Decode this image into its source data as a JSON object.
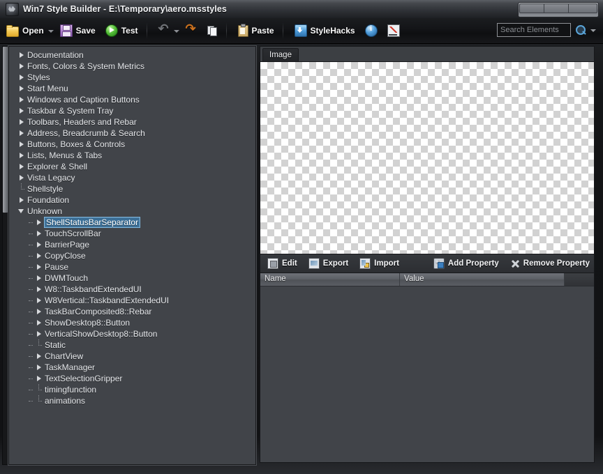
{
  "window": {
    "title": "Win7 Style Builder - E:\\Temporary\\aero.msstyles",
    "icon": "app-icon",
    "controls": [
      "minimize-button",
      "maximize-button",
      "close-button"
    ]
  },
  "toolbar": {
    "open_label": "Open",
    "save_label": "Save",
    "test_label": "Test",
    "paste_label": "Paste",
    "stylehacks_label": "StyleHacks",
    "undo_icon": "undo-icon",
    "undo_dropdown_icon": "chevron-down-icon",
    "redo_icon": "redo-icon",
    "copy_icon": "copy-icon",
    "info_icon": "info-icon",
    "chart_icon": "chart-icon"
  },
  "search": {
    "value": "",
    "placeholder": "Search Elements",
    "search_icon": "search-icon",
    "dropdown_icon": "chevron-down-icon"
  },
  "tree": {
    "items": [
      {
        "label": "Documentation",
        "indent": 0,
        "state": "collapsed"
      },
      {
        "label": "Fonts, Colors & System Metrics",
        "indent": 0,
        "state": "collapsed"
      },
      {
        "label": "Styles",
        "indent": 0,
        "state": "collapsed"
      },
      {
        "label": "Start Menu",
        "indent": 0,
        "state": "collapsed"
      },
      {
        "label": "Windows and Caption Buttons",
        "indent": 0,
        "state": "collapsed"
      },
      {
        "label": "Taskbar & System Tray",
        "indent": 0,
        "state": "collapsed"
      },
      {
        "label": "Toolbars, Headers and Rebar",
        "indent": 0,
        "state": "collapsed"
      },
      {
        "label": "Address, Breadcrumb & Search",
        "indent": 0,
        "state": "collapsed"
      },
      {
        "label": "Buttons, Boxes & Controls",
        "indent": 0,
        "state": "collapsed"
      },
      {
        "label": "Lists, Menus & Tabs",
        "indent": 0,
        "state": "collapsed"
      },
      {
        "label": "Explorer & Shell",
        "indent": 0,
        "state": "collapsed"
      },
      {
        "label": "Vista Legacy",
        "indent": 0,
        "state": "collapsed"
      },
      {
        "label": "Shellstyle",
        "indent": 0,
        "state": "leaf"
      },
      {
        "label": "Foundation",
        "indent": 0,
        "state": "collapsed"
      },
      {
        "label": "Unknown",
        "indent": 0,
        "state": "expanded"
      },
      {
        "label": "ShellStatusBarSeparator",
        "indent": 1,
        "state": "collapsed",
        "selected": true
      },
      {
        "label": "TouchScrollBar",
        "indent": 1,
        "state": "collapsed"
      },
      {
        "label": "BarrierPage",
        "indent": 1,
        "state": "collapsed"
      },
      {
        "label": "CopyClose",
        "indent": 1,
        "state": "collapsed"
      },
      {
        "label": "Pause",
        "indent": 1,
        "state": "collapsed"
      },
      {
        "label": "DWMTouch",
        "indent": 1,
        "state": "collapsed"
      },
      {
        "label": "W8::TaskbandExtendedUI",
        "indent": 1,
        "state": "collapsed"
      },
      {
        "label": "W8Vertical::TaskbandExtendedUI",
        "indent": 1,
        "state": "collapsed"
      },
      {
        "label": "TaskBarComposited8::Rebar",
        "indent": 1,
        "state": "collapsed"
      },
      {
        "label": "ShowDesktop8::Button",
        "indent": 1,
        "state": "collapsed"
      },
      {
        "label": "VerticalShowDesktop8::Button",
        "indent": 1,
        "state": "collapsed"
      },
      {
        "label": "Static",
        "indent": 1,
        "state": "leaf"
      },
      {
        "label": "ChartView",
        "indent": 1,
        "state": "collapsed"
      },
      {
        "label": "TaskManager",
        "indent": 1,
        "state": "collapsed"
      },
      {
        "label": "TextSelectionGripper",
        "indent": 1,
        "state": "collapsed"
      },
      {
        "label": "timingfunction",
        "indent": 1,
        "state": "leaf"
      },
      {
        "label": "animations",
        "indent": 1,
        "state": "leaf"
      }
    ]
  },
  "right": {
    "tab_label": "Image",
    "image_preview": "transparent-checkerboard",
    "property_toolbar": {
      "edit_label": "Edit",
      "export_label": "Export",
      "import_label": "Import",
      "add_property_label": "Add Property",
      "remove_property_label": "Remove Property"
    },
    "grid": {
      "columns": [
        "Name",
        "Value"
      ],
      "rows": []
    }
  },
  "colors": {
    "panel_bg": "#414449",
    "chrome_dark": "#141517",
    "selection": "#3a6e96",
    "selection_border": "#7fb6dd",
    "accent_blue": "#4f9ddb",
    "text": "#e4e6e9"
  }
}
